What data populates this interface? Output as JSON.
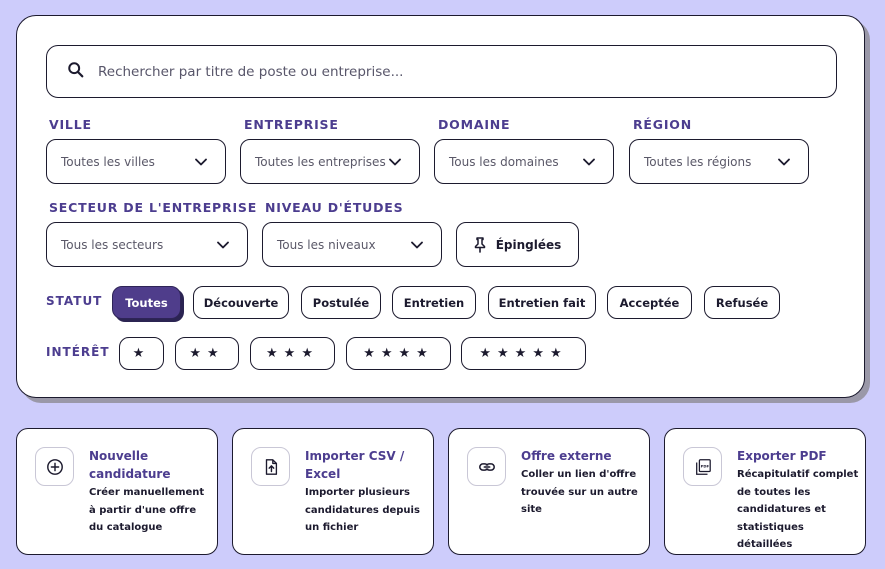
{
  "search": {
    "placeholder": "Rechercher par titre de poste ou entreprise..."
  },
  "filters": [
    {
      "label": "VILLE",
      "value": "Toutes les villes"
    },
    {
      "label": "ENTREPRISE",
      "value": "Toutes les entreprises"
    },
    {
      "label": "DOMAINE",
      "value": "Tous les domaines"
    },
    {
      "label": "RÉGION",
      "value": "Toutes les régions"
    },
    {
      "label": "SECTEUR DE L'ENTREPRISE",
      "value": "Tous les secteurs"
    },
    {
      "label": "NIVEAU D'ÉTUDES",
      "value": "Tous les niveaux"
    }
  ],
  "pinned_button": {
    "label": "Épinglées",
    "icon": "pin-icon"
  },
  "status": {
    "label": "STATUT",
    "selected": "Toutes",
    "options": [
      "Toutes",
      "Découverte",
      "Postulée",
      "Entretien",
      "Entretien fait",
      "Acceptée",
      "Refusée"
    ]
  },
  "interest": {
    "label": "INTÉRÊT",
    "options": [
      "★",
      "★★",
      "★★★",
      "★★★★",
      "★★★★★"
    ]
  },
  "actions": [
    {
      "title": "Nouvelle candidature",
      "desc": "Créer manuellement à partir d'une offre du catalogue",
      "icon": "plus-circle-icon"
    },
    {
      "title": "Importer CSV / Excel",
      "desc": "Importer plusieurs candidatures depuis un fichier",
      "icon": "file-upload-icon"
    },
    {
      "title": "Offre externe",
      "desc": "Coller un lien d'offre trouvée sur un autre site",
      "icon": "link-icon"
    },
    {
      "title": "Exporter PDF",
      "desc": "Récapitulatif complet de toutes les candidatures et statistiques détaillées",
      "icon": "pdf-icon"
    }
  ],
  "colors": {
    "accent": "#4f3d8b",
    "background": "#cdccfb",
    "label": "#4c3d8f"
  }
}
